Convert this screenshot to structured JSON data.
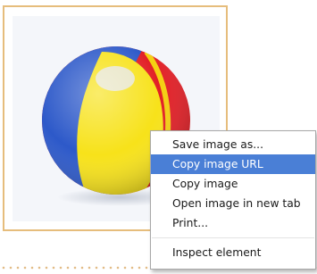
{
  "image": {
    "subject_icon": "beach-ball-image",
    "colors": {
      "frame_border": "#e6bd7c",
      "background": "#f4f6fa",
      "ball_red": "#e21f26",
      "ball_yellow": "#f7e21a",
      "ball_blue": "#2d59c9"
    }
  },
  "context_menu": {
    "items": [
      {
        "label": "Save image as...",
        "highlighted": false
      },
      {
        "label": "Copy image URL",
        "highlighted": true
      },
      {
        "label": "Copy image",
        "highlighted": false
      },
      {
        "label": "Open image in new tab",
        "highlighted": false
      },
      {
        "label": "Print...",
        "highlighted": false
      }
    ],
    "bottom_items": [
      {
        "label": "Inspect element",
        "highlighted": false
      }
    ],
    "highlight_color": "#4a7fd6"
  }
}
